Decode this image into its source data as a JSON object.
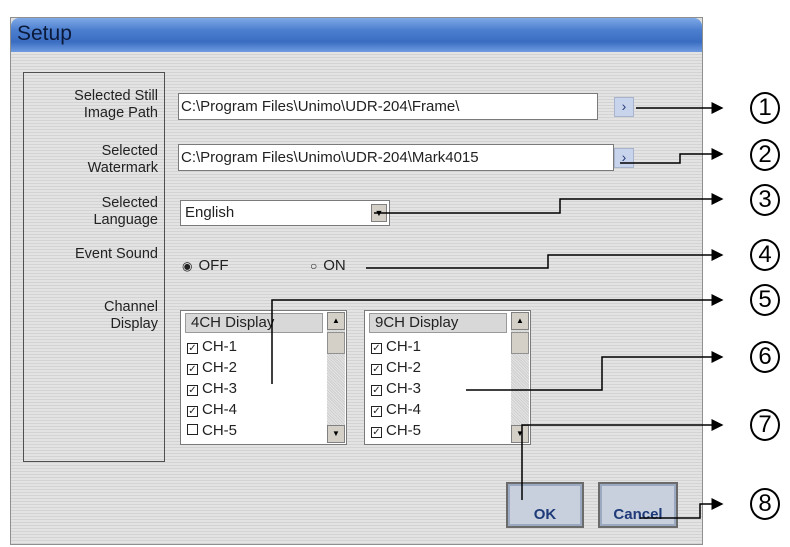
{
  "window": {
    "title": "Setup"
  },
  "labels": {
    "still_image_path": "Selected Still\nImage Path",
    "watermark": "Selected\nWatermark",
    "language": "Selected\nLanguage",
    "event_sound": "Event Sound",
    "channel_display": "Channel\nDisplay"
  },
  "fields": {
    "still_image_path": "C:\\Program Files\\Unimo\\UDR-204\\Frame\\",
    "watermark": "C:\\Program Files\\Unimo\\UDR-204\\Mark4015"
  },
  "language": {
    "selected": "English"
  },
  "event_sound": {
    "off_label": "OFF",
    "on_label": "ON",
    "selected": "OFF"
  },
  "lists": {
    "ch4": {
      "header": "4CH Display",
      "items": [
        "CH-1",
        "CH-2",
        "CH-3",
        "CH-4",
        "CH-5"
      ]
    },
    "ch9": {
      "header": "9CH Display",
      "items": [
        "CH-1",
        "CH-2",
        "CH-3",
        "CH-4",
        "CH-5"
      ]
    }
  },
  "buttons": {
    "ok": "OK",
    "cancel": "Cancel"
  },
  "callouts": [
    "1",
    "2",
    "3",
    "4",
    "5",
    "6",
    "7",
    "8"
  ],
  "glyphs": {
    "browse": "›",
    "dropdown": "▼",
    "up": "▲",
    "down": "▼",
    "check": "✓",
    "radio_on": "◉",
    "radio_off": "○"
  },
  "colors": {
    "titlebar": "#3a6dc2",
    "dialog_bg": "#dfdfdf",
    "button_text": "#1e3a78"
  }
}
